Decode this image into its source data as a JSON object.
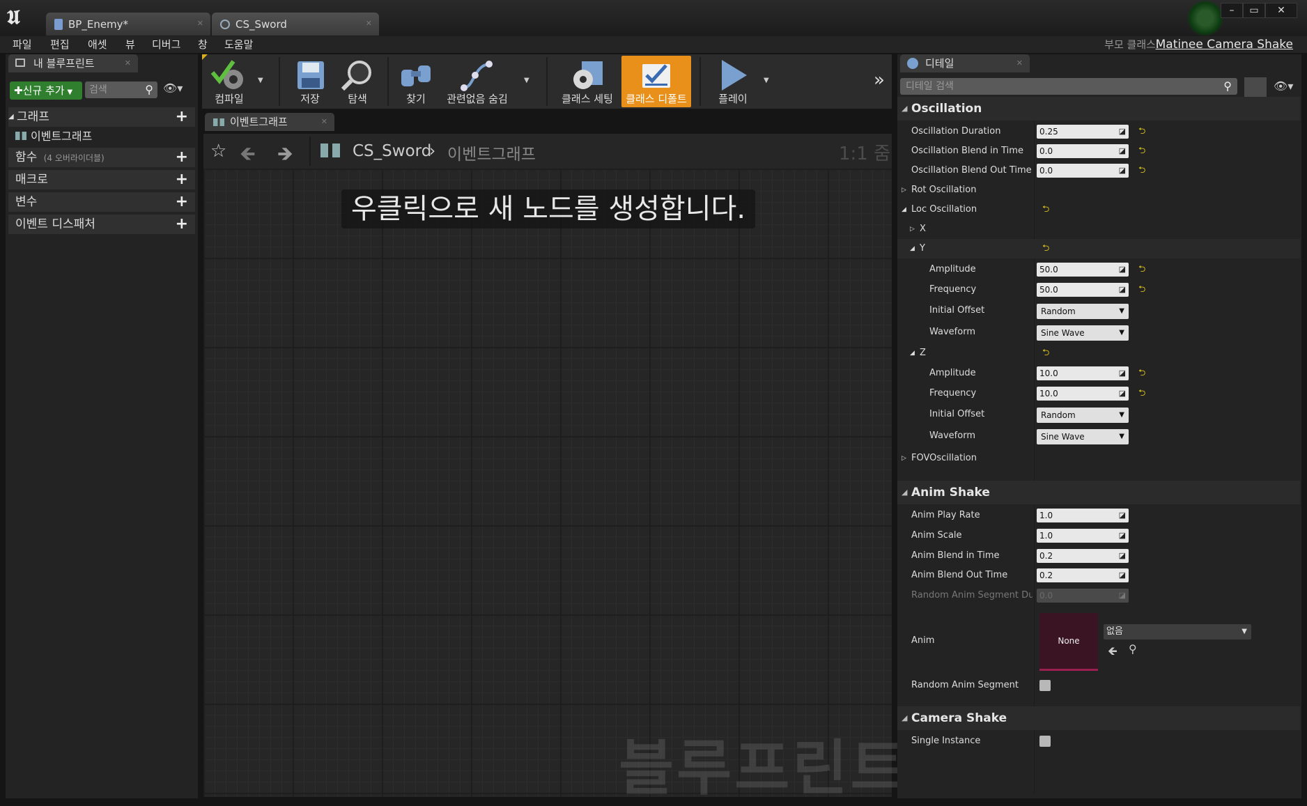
{
  "window": {
    "tabs": [
      {
        "label": "BP_Enemy*"
      },
      {
        "label": "CS_Sword"
      }
    ],
    "controls": {
      "minimize": "–",
      "maximize": "▭",
      "close": "✕"
    }
  },
  "menu": {
    "items": [
      "파일",
      "편집",
      "애셋",
      "뷰",
      "디버그",
      "창",
      "도움말"
    ],
    "parent_class_label": "부모 클래스:",
    "parent_class_value": "Matinee Camera Shake"
  },
  "my_blueprint": {
    "tab_label": "내 블루프린트",
    "add_new_label": "신규 추가",
    "search_placeholder": "검색",
    "categories": [
      {
        "label": "그래프"
      },
      {
        "label": "함수",
        "note": "(4 오버라이더블)"
      },
      {
        "label": "매크로"
      },
      {
        "label": "변수"
      },
      {
        "label": "이벤트 디스패처"
      }
    ],
    "graph_items": [
      "이벤트그래프"
    ]
  },
  "toolbar": {
    "compile": "컴파일",
    "save": "저장",
    "browse": "탐색",
    "find": "찾기",
    "hide_unrelated": "관련없음 숨김",
    "class_settings": "클래스 세팅",
    "class_defaults": "클래스 디폴트",
    "play": "플레이",
    "active_color": "#e8901a"
  },
  "graph": {
    "tab_label": "이벤트그래프",
    "breadcrumb": [
      "CS_Sword",
      "이벤트그래프"
    ],
    "zoom": "1:1 줌",
    "hint": "우클릭으로 새 노드를 생성합니다.",
    "watermark": "블루프린트"
  },
  "details": {
    "tab_label": "디테일",
    "search_placeholder": "디테일 검색",
    "oscillation": {
      "header": "Oscillation",
      "duration_label": "Oscillation Duration",
      "duration": "0.25",
      "blend_in_label": "Oscillation Blend in Time",
      "blend_in": "0.0",
      "blend_out_label": "Oscillation Blend Out Time",
      "blend_out": "0.0",
      "rot_label": "Rot Oscillation",
      "loc_label": "Loc Oscillation",
      "x_label": "X",
      "y_label": "Y",
      "y_amplitude_label": "Amplitude",
      "y_amplitude": "50.0",
      "y_frequency_label": "Frequency",
      "y_frequency": "50.0",
      "y_initial_offset_label": "Initial Offset",
      "y_initial_offset": "Random",
      "y_waveform_label": "Waveform",
      "y_waveform": "Sine Wave",
      "z_label": "Z",
      "z_amplitude_label": "Amplitude",
      "z_amplitude": "10.0",
      "z_frequency_label": "Frequency",
      "z_frequency": "10.0",
      "z_initial_offset_label": "Initial Offset",
      "z_initial_offset": "Random",
      "z_waveform_label": "Waveform",
      "z_waveform": "Sine Wave",
      "fov_label": "FOVOscillation"
    },
    "anim_shake": {
      "header": "Anim Shake",
      "play_rate_label": "Anim Play Rate",
      "play_rate": "1.0",
      "scale_label": "Anim Scale",
      "scale": "1.0",
      "blend_in_label": "Anim Blend in Time",
      "blend_in": "0.2",
      "blend_out_label": "Anim Blend Out Time",
      "blend_out": "0.2",
      "random_duration_label": "Random Anim Segment Duration",
      "random_duration": "0.0",
      "anim_label": "Anim",
      "anim_thumb": "None",
      "anim_value": "없음",
      "random_segment_label": "Random Anim Segment"
    },
    "camera_shake": {
      "header": "Camera Shake",
      "single_instance_label": "Single Instance"
    }
  }
}
